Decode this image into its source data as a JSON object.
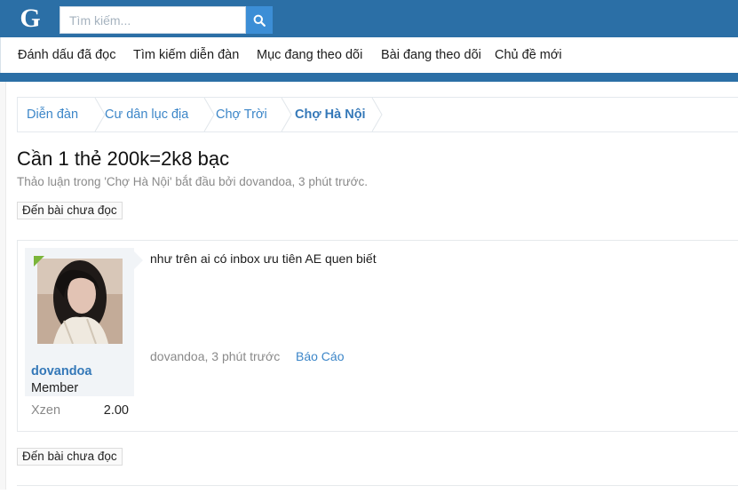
{
  "header": {
    "logo": "G",
    "search": {
      "placeholder": "Tìm kiếm..."
    },
    "colors": {
      "brand": "#2b6fa6",
      "search_button": "#3c8ed6",
      "link": "#3478b8"
    }
  },
  "nav": {
    "items": [
      {
        "label": "Đánh dấu đã đọc"
      },
      {
        "label": "Tìm kiếm diễn đàn"
      },
      {
        "label": "Mục đang theo dõi"
      },
      {
        "label": "Bài đang theo dõi"
      },
      {
        "label": "Chủ đề mới"
      }
    ]
  },
  "breadcrumb": {
    "items": [
      {
        "label": "Diễn đàn"
      },
      {
        "label": "Cư dân lục địa"
      },
      {
        "label": "Chợ Trời"
      },
      {
        "label": "Chợ Hà Nội"
      }
    ]
  },
  "thread": {
    "title": "Cần 1 thẻ 200k=2k8 bạc",
    "meta": "Thảo luận trong 'Chợ Hà Nội' bắt đầu bởi dovandoa, 3 phút trước.",
    "unread_label": "Đến bài chưa đọc"
  },
  "post": {
    "username": "dovandoa",
    "user_title": "Member",
    "stat_label": "Xzen",
    "stat_value": "2.00",
    "body": "như trên ai có inbox ưu tiên AE quen biết",
    "author_time": "dovandoa, 3 phút trước",
    "report_label": "Báo Cáo",
    "online": true
  }
}
